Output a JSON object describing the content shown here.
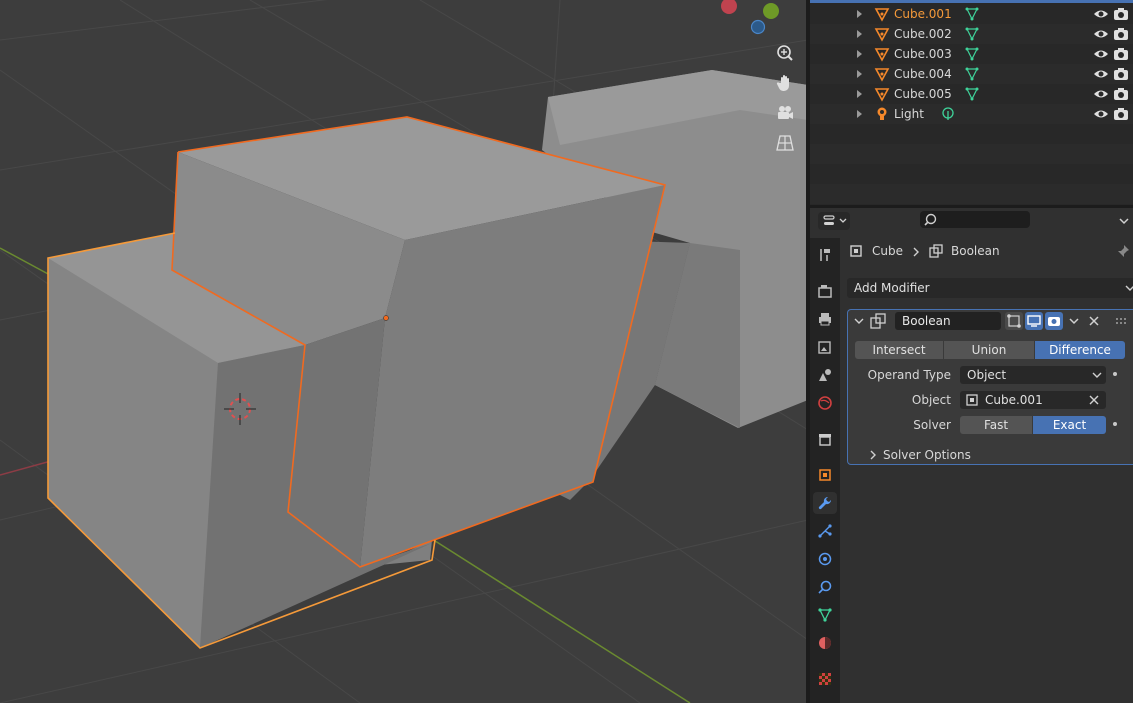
{
  "outliner": {
    "items": [
      {
        "name": "Cube.001",
        "active": true
      },
      {
        "name": "Cube.002",
        "active": false
      },
      {
        "name": "Cube.003",
        "active": false
      },
      {
        "name": "Cube.004",
        "active": false
      },
      {
        "name": "Cube.005",
        "active": false
      },
      {
        "name": "Light",
        "active": false
      }
    ]
  },
  "properties": {
    "breadcrumb": {
      "object": "Cube",
      "modifier": "Boolean"
    },
    "add_modifier_label": "Add Modifier",
    "modifier": {
      "name": "Boolean",
      "operations": [
        "Intersect",
        "Union",
        "Difference"
      ],
      "selected_operation": "Difference",
      "operand_type_label": "Operand Type",
      "operand_type_value": "Object",
      "object_label": "Object",
      "object_value": "Cube.001",
      "solver_label": "Solver",
      "solvers": [
        "Fast",
        "Exact"
      ],
      "selected_solver": "Exact",
      "solver_options_label": "Solver Options"
    }
  },
  "colors": {
    "accent": "#4772b3",
    "selected_outline": "#f5882a",
    "active_text": "#f59a3a",
    "mesh_gray": "#8a8a8a"
  }
}
